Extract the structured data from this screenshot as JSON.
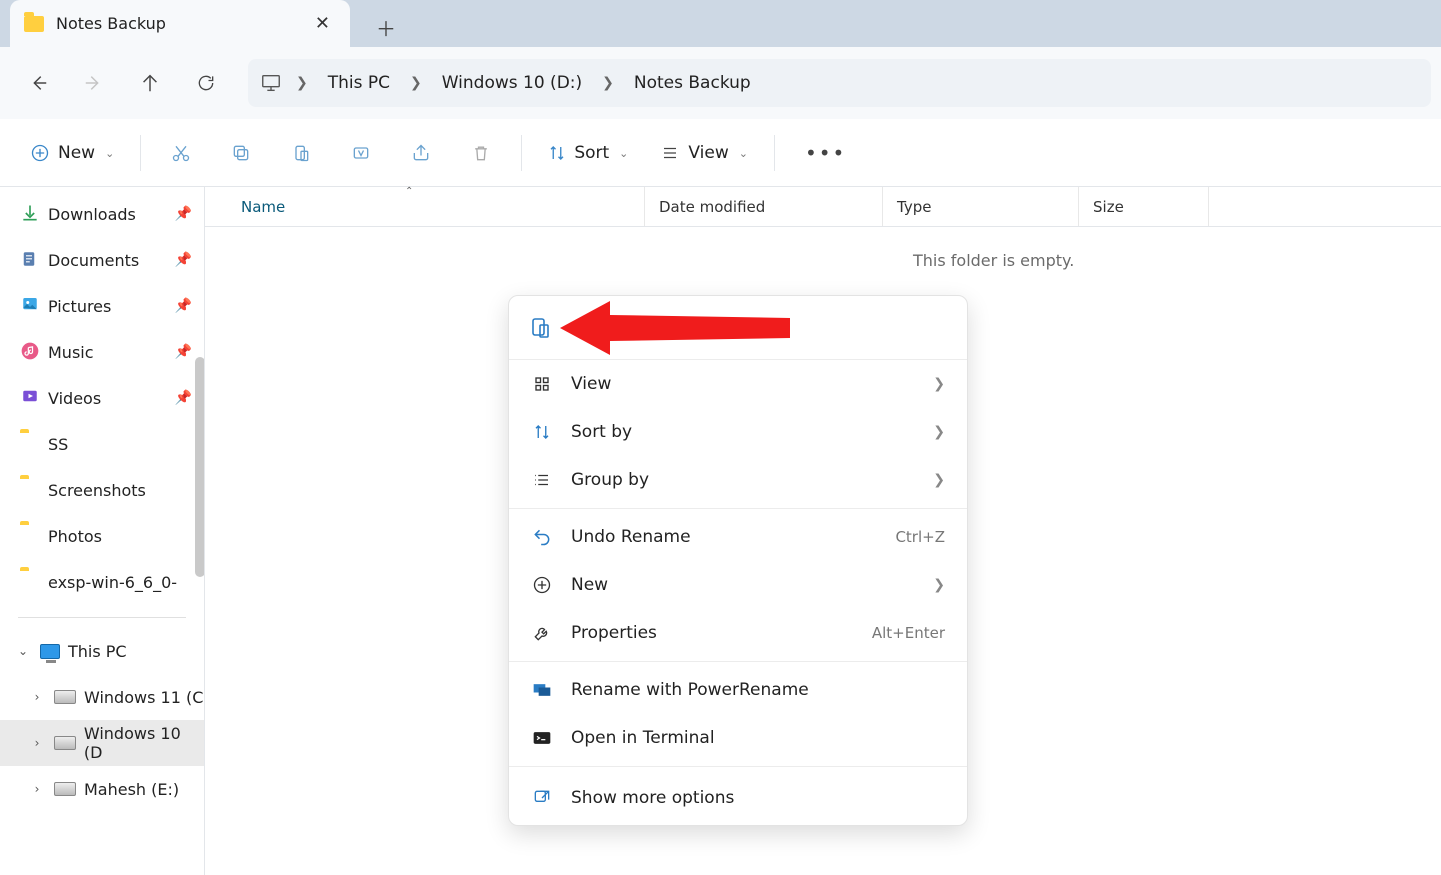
{
  "tab": {
    "title": "Notes Backup"
  },
  "breadcrumb": {
    "items": [
      "This PC",
      "Windows 10 (D:)",
      "Notes Backup"
    ]
  },
  "toolbar": {
    "new_label": "New",
    "sort_label": "Sort",
    "view_label": "View"
  },
  "sidebar": {
    "pinned": [
      {
        "label": "Downloads",
        "icon": "download"
      },
      {
        "label": "Documents",
        "icon": "document"
      },
      {
        "label": "Pictures",
        "icon": "pictures"
      },
      {
        "label": "Music",
        "icon": "music"
      },
      {
        "label": "Videos",
        "icon": "videos"
      },
      {
        "label": "SS",
        "icon": "folder"
      },
      {
        "label": "Screenshots",
        "icon": "folder"
      },
      {
        "label": "Photos",
        "icon": "folder"
      },
      {
        "label": "exsp-win-6_6_0-",
        "icon": "folder"
      }
    ],
    "this_pc_label": "This PC",
    "drives": [
      {
        "label": "Windows 11 (C"
      },
      {
        "label": "Windows 10 (D"
      },
      {
        "label": "Mahesh (E:)"
      }
    ]
  },
  "columns": {
    "name": "Name",
    "date": "Date modified",
    "type": "Type",
    "size": "Size"
  },
  "empty_message": "This folder is empty.",
  "context_menu": {
    "view": "View",
    "sort_by": "Sort by",
    "group_by": "Group by",
    "undo_rename": "Undo Rename",
    "undo_rename_shortcut": "Ctrl+Z",
    "new": "New",
    "properties": "Properties",
    "properties_shortcut": "Alt+Enter",
    "rename_power": "Rename with PowerRename",
    "open_terminal": "Open in Terminal",
    "show_more": "Show more options"
  }
}
